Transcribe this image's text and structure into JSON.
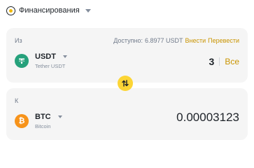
{
  "header": {
    "account_label": "Финансирования",
    "account_icon": "wallet-icon"
  },
  "from": {
    "label": "Из",
    "available_label": "Доступно:",
    "available_value": "6.8977 USDT",
    "deposit_label": "Внести",
    "transfer_label": "Перевести",
    "asset_symbol": "USDT",
    "asset_name": "Tether USDT",
    "amount": "3",
    "max_label": "Все"
  },
  "to": {
    "label": "К",
    "asset_symbol": "BTC",
    "asset_name": "Bitcoin",
    "coin_glyph": "₿",
    "amount": "0.00003123"
  },
  "colors": {
    "accent": "#c99400",
    "swap_button": "#fcd535",
    "usdt": "#26a17b",
    "btc": "#f7931a",
    "card_bg": "#f5f5f5"
  }
}
